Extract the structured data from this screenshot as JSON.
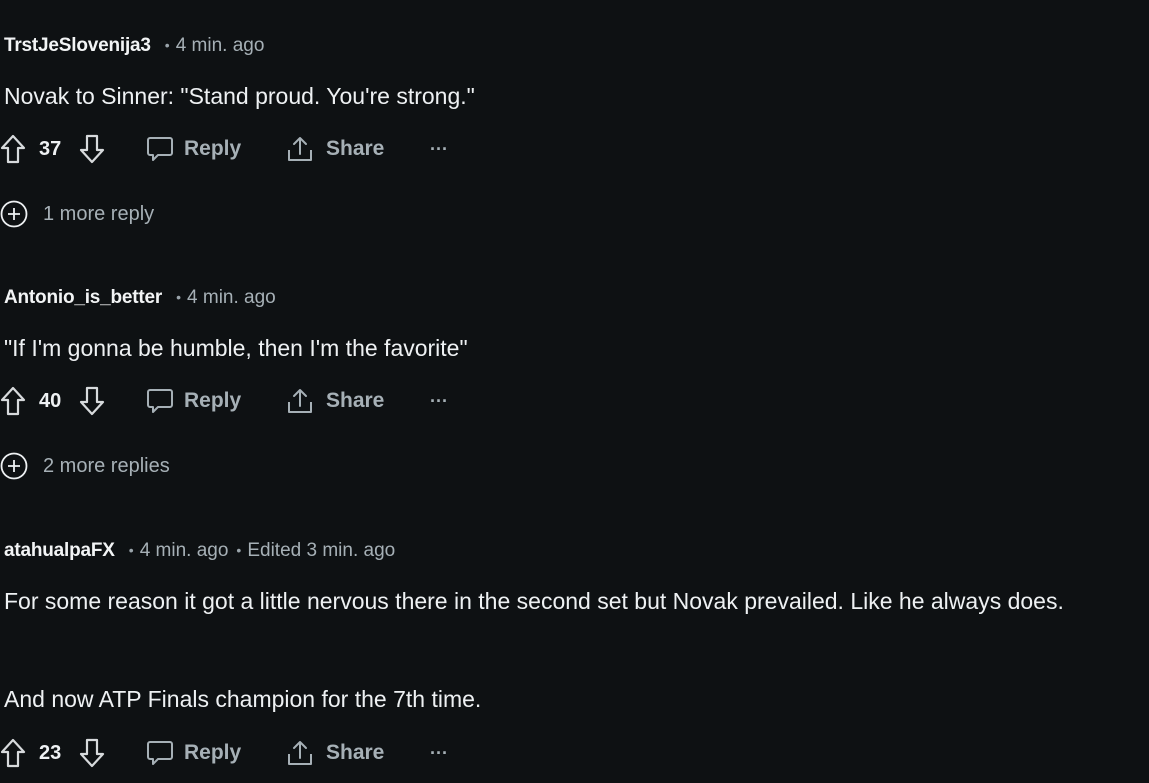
{
  "comments": [
    {
      "author": "TrstJeSlovenija3",
      "time": "4 min. ago",
      "edited": "",
      "body": [
        "Novak to Sinner: \"Stand proud. You're strong.\""
      ],
      "votes": "37",
      "more_replies": "1 more reply"
    },
    {
      "author": "Antonio_is_better",
      "time": "4 min. ago",
      "edited": "",
      "body": [
        "\"If I'm gonna be humble, then I'm the favorite\""
      ],
      "votes": "40",
      "more_replies": "2 more replies"
    },
    {
      "author": "atahualpaFX",
      "time": "4 min. ago",
      "edited": "Edited 3 min. ago",
      "body": [
        "For some reason it got a little nervous there in the second set but Novak prevailed. Like he always does.",
        "And now ATP Finals champion for the 7th time."
      ],
      "votes": "23",
      "more_replies": ""
    }
  ],
  "actions": {
    "reply_label": "Reply",
    "share_label": "Share",
    "more_glyph": "···"
  },
  "icons": {
    "upvote": "upvote-arrow-icon",
    "downvote": "downvote-arrow-icon",
    "reply": "speech-bubble-icon",
    "share": "share-upload-icon",
    "more": "ellipsis-icon",
    "expand": "plus-circle-icon"
  },
  "colors": {
    "background": "#0e1113",
    "author": "#f2f4f5",
    "meta": "#a6b0b6",
    "body": "#eef1f3"
  }
}
